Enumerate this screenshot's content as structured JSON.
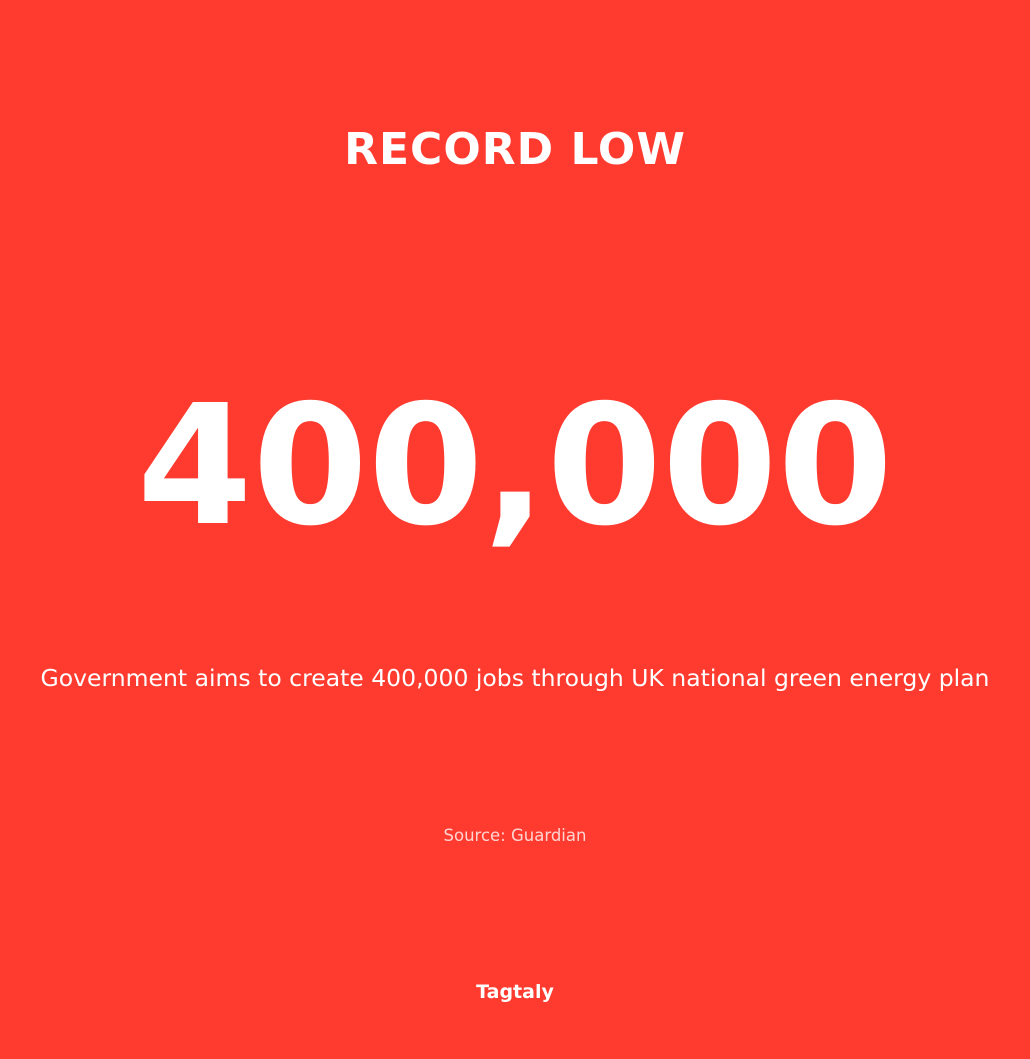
{
  "card": {
    "background_color": "#FF3B30",
    "text_color": "#FFFFFF",
    "headline": "RECORD LOW",
    "big_number": "400,000",
    "description": "Government aims to create 400,000 jobs through UK national green energy plan",
    "source": "Source: Guardian",
    "brand": "Tagtaly"
  }
}
